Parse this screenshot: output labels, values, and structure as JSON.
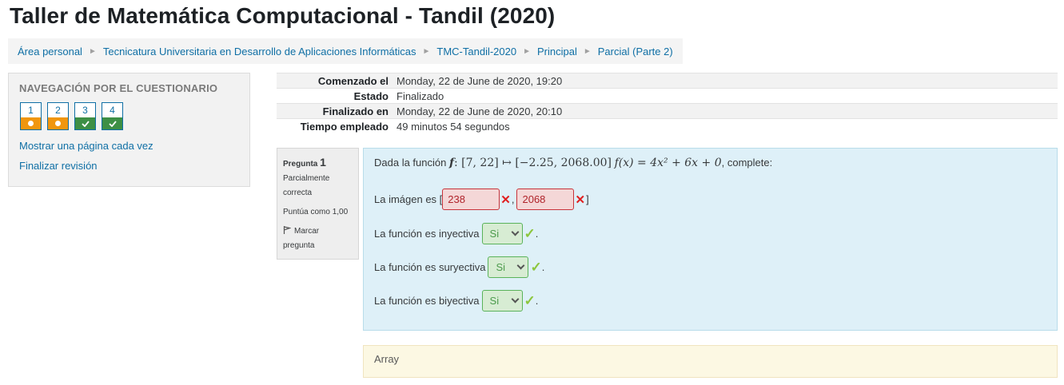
{
  "page": {
    "title": "Taller de Matemática Computacional - Tandil (2020)"
  },
  "breadcrumb": [
    "Área personal",
    "Tecnicatura Universitaria en Desarrollo de Aplicaciones Informáticas",
    "TMC-Tandil-2020",
    "Principal",
    "Parcial (Parte 2)"
  ],
  "breadcrumb_separator": "►",
  "quiz_nav": {
    "title": "NAVEGACIÓN POR EL CUESTIONARIO",
    "questions": [
      {
        "number": "1",
        "state": "partial"
      },
      {
        "number": "2",
        "state": "partial"
      },
      {
        "number": "3",
        "state": "correct"
      },
      {
        "number": "4",
        "state": "correct"
      }
    ],
    "show_one_page": "Mostrar una página cada vez",
    "finish_review": "Finalizar revisión"
  },
  "summary": [
    {
      "label": "Comenzado el",
      "value": "Monday, 22 de June de 2020, 19:20"
    },
    {
      "label": "Estado",
      "value": "Finalizado"
    },
    {
      "label": "Finalizado en",
      "value": "Monday, 22 de June de 2020, 20:10"
    },
    {
      "label": "Tiempo empleado",
      "value": "49 minutos 54 segundos"
    }
  ],
  "question": {
    "label": "Pregunta",
    "number": "1",
    "status": "Parcialmente correcta",
    "grade": "Puntúa como 1,00",
    "flag": "Marcar pregunta",
    "intro": "Dada la función",
    "math": {
      "f": "f",
      "domain": ": [7, 22] ↦ [−2.25, 2068.00]",
      "fx": "f(x) = 4x² + 6x + 0"
    },
    "intro_end": ", complete:",
    "image_label": "La imágen es [",
    "image_sep": ",",
    "image_close": "]",
    "image_values": [
      "238",
      "2068"
    ],
    "injective_label": "La función es inyectiva",
    "injective_value": "Si",
    "surjective_label": "La función es suryectiva",
    "surjective_value": "Si",
    "bijective_label": "La función es biyectiva",
    "bijective_value": "Si",
    "period": "."
  },
  "feedback": {
    "text": "Array"
  },
  "colors": {
    "link": "#0f6fa5",
    "partial": "#f0960e",
    "correct": "#3d8f45",
    "question_bg": "#def0f8",
    "feedback_bg": "#fcf8e3"
  }
}
